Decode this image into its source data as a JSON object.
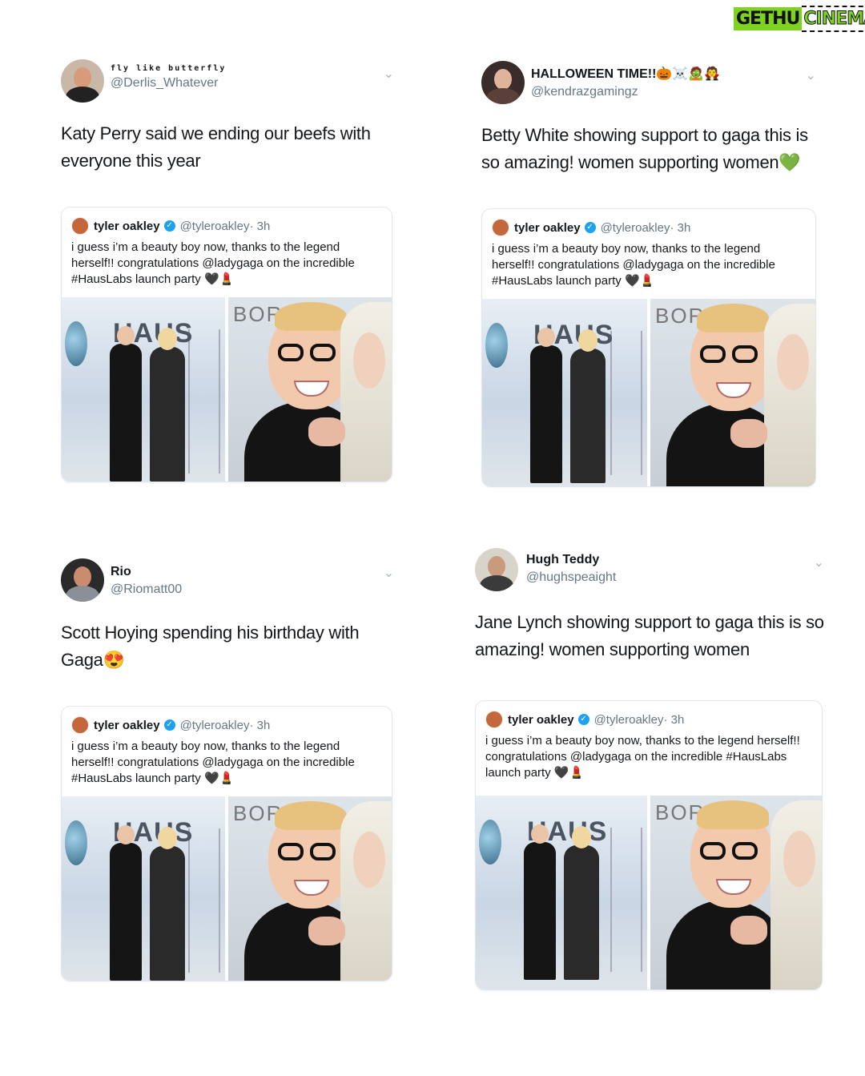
{
  "watermark": {
    "part1": "GETHU",
    "part2": "CINEMA"
  },
  "quoted_tweet": {
    "name": "tyler oakley",
    "handle": "@tyleroakley",
    "time": "· 3h",
    "text": "i guess i’m a beauty boy now, thanks to the legend herself!! congratulations @ladygaga on the incredible #HausLabs launch party 🖤💄",
    "photo1_sign": "HAUS",
    "photo2_sign": "BOR"
  },
  "tweets": [
    {
      "display_name": "fly like butterfly",
      "handle": "@Derlis_Whatever",
      "text": "Katy Perry said we ending our beefs with everyone this year"
    },
    {
      "display_name": "HALLOWEEN TIME!!🎃☠️🧟🧛",
      "handle": "@kendrazgamingz",
      "text": "Betty White showing support to gaga this is so amazing! women supporting women💚"
    },
    {
      "display_name": "Rio",
      "handle": "@Riomatt00",
      "text": "Scott Hoying spending his birthday with Gaga😍"
    },
    {
      "display_name": "Hugh Teddy",
      "handle": "@hughspeaight",
      "text": "Jane Lynch showing support to gaga this is so amazing! women supporting women"
    }
  ],
  "icons": {
    "verified": "verified-badge-icon",
    "caret": "chevron-down-icon"
  },
  "colors": {
    "link_gray": "#657786",
    "verified": "#1da1f2",
    "border": "#e1e8ed"
  }
}
